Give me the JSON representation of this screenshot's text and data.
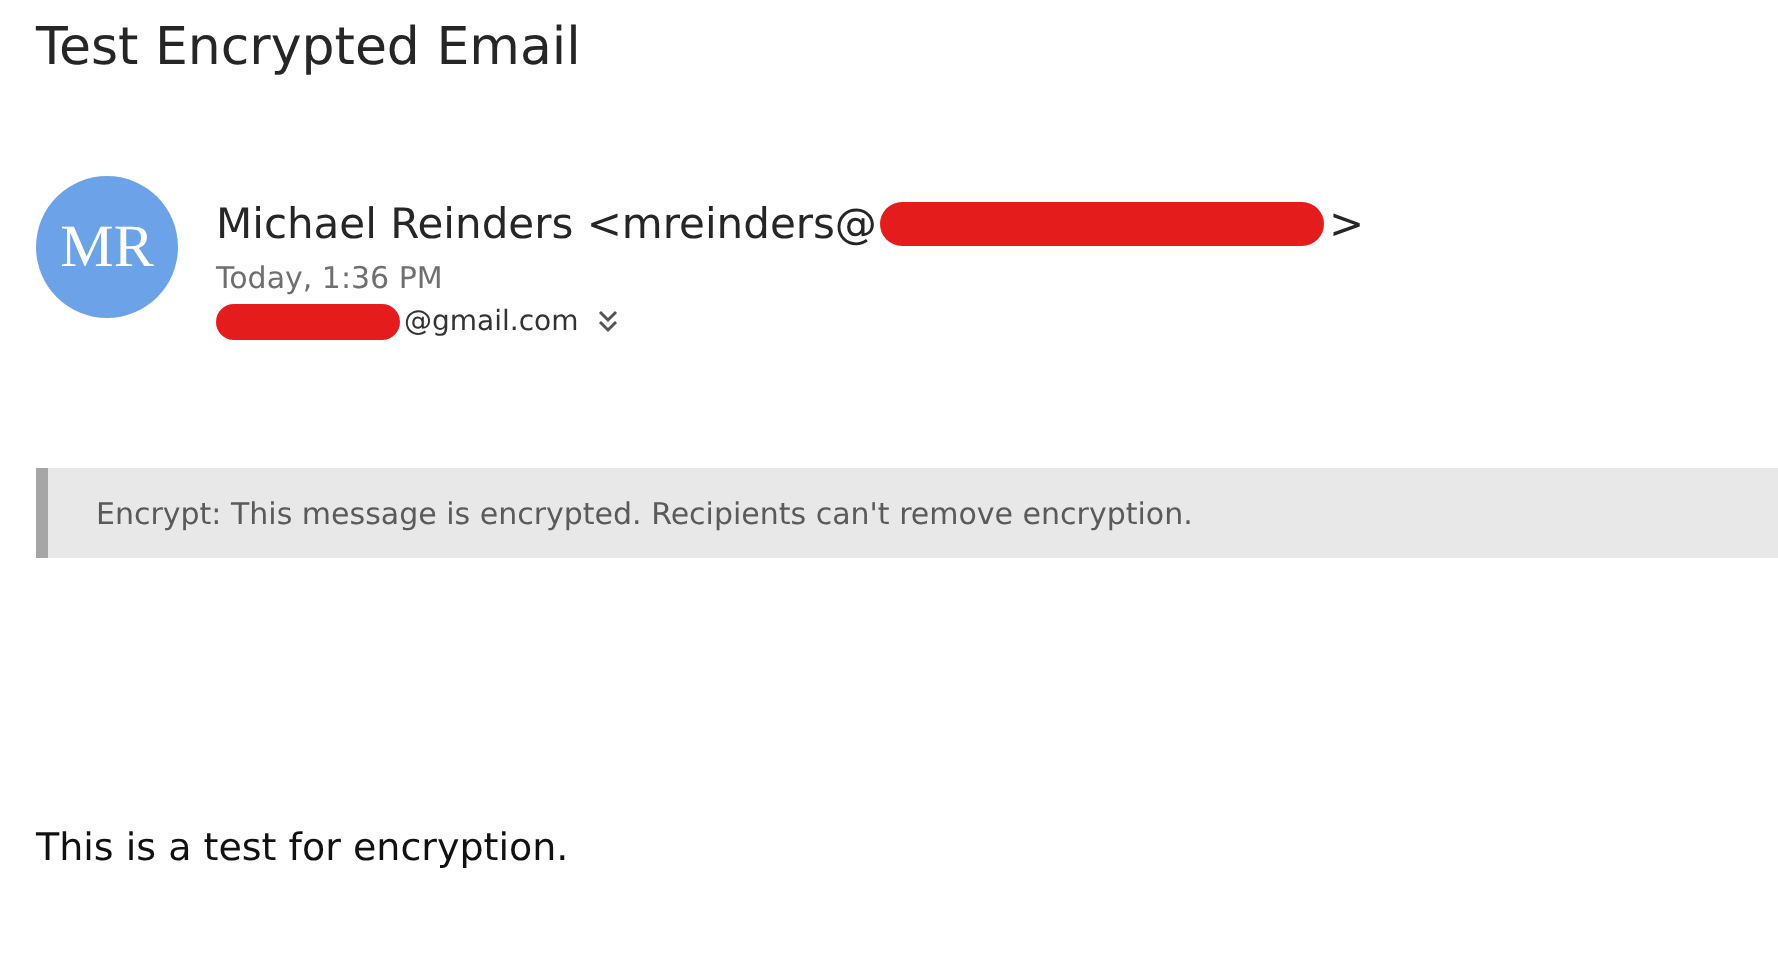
{
  "subject": "Test Encrypted Email",
  "sender": {
    "initials": "MR",
    "name_prefix": "Michael Reinders <mreinders@",
    "name_suffix": ">",
    "redacted": true
  },
  "date": "Today, 1:36 PM",
  "recipient": {
    "redacted": true,
    "text": "@gmail.com"
  },
  "banner": "Encrypt: This message is encrypted. Recipients can't remove encryption.",
  "body": "This is a test for encryption."
}
